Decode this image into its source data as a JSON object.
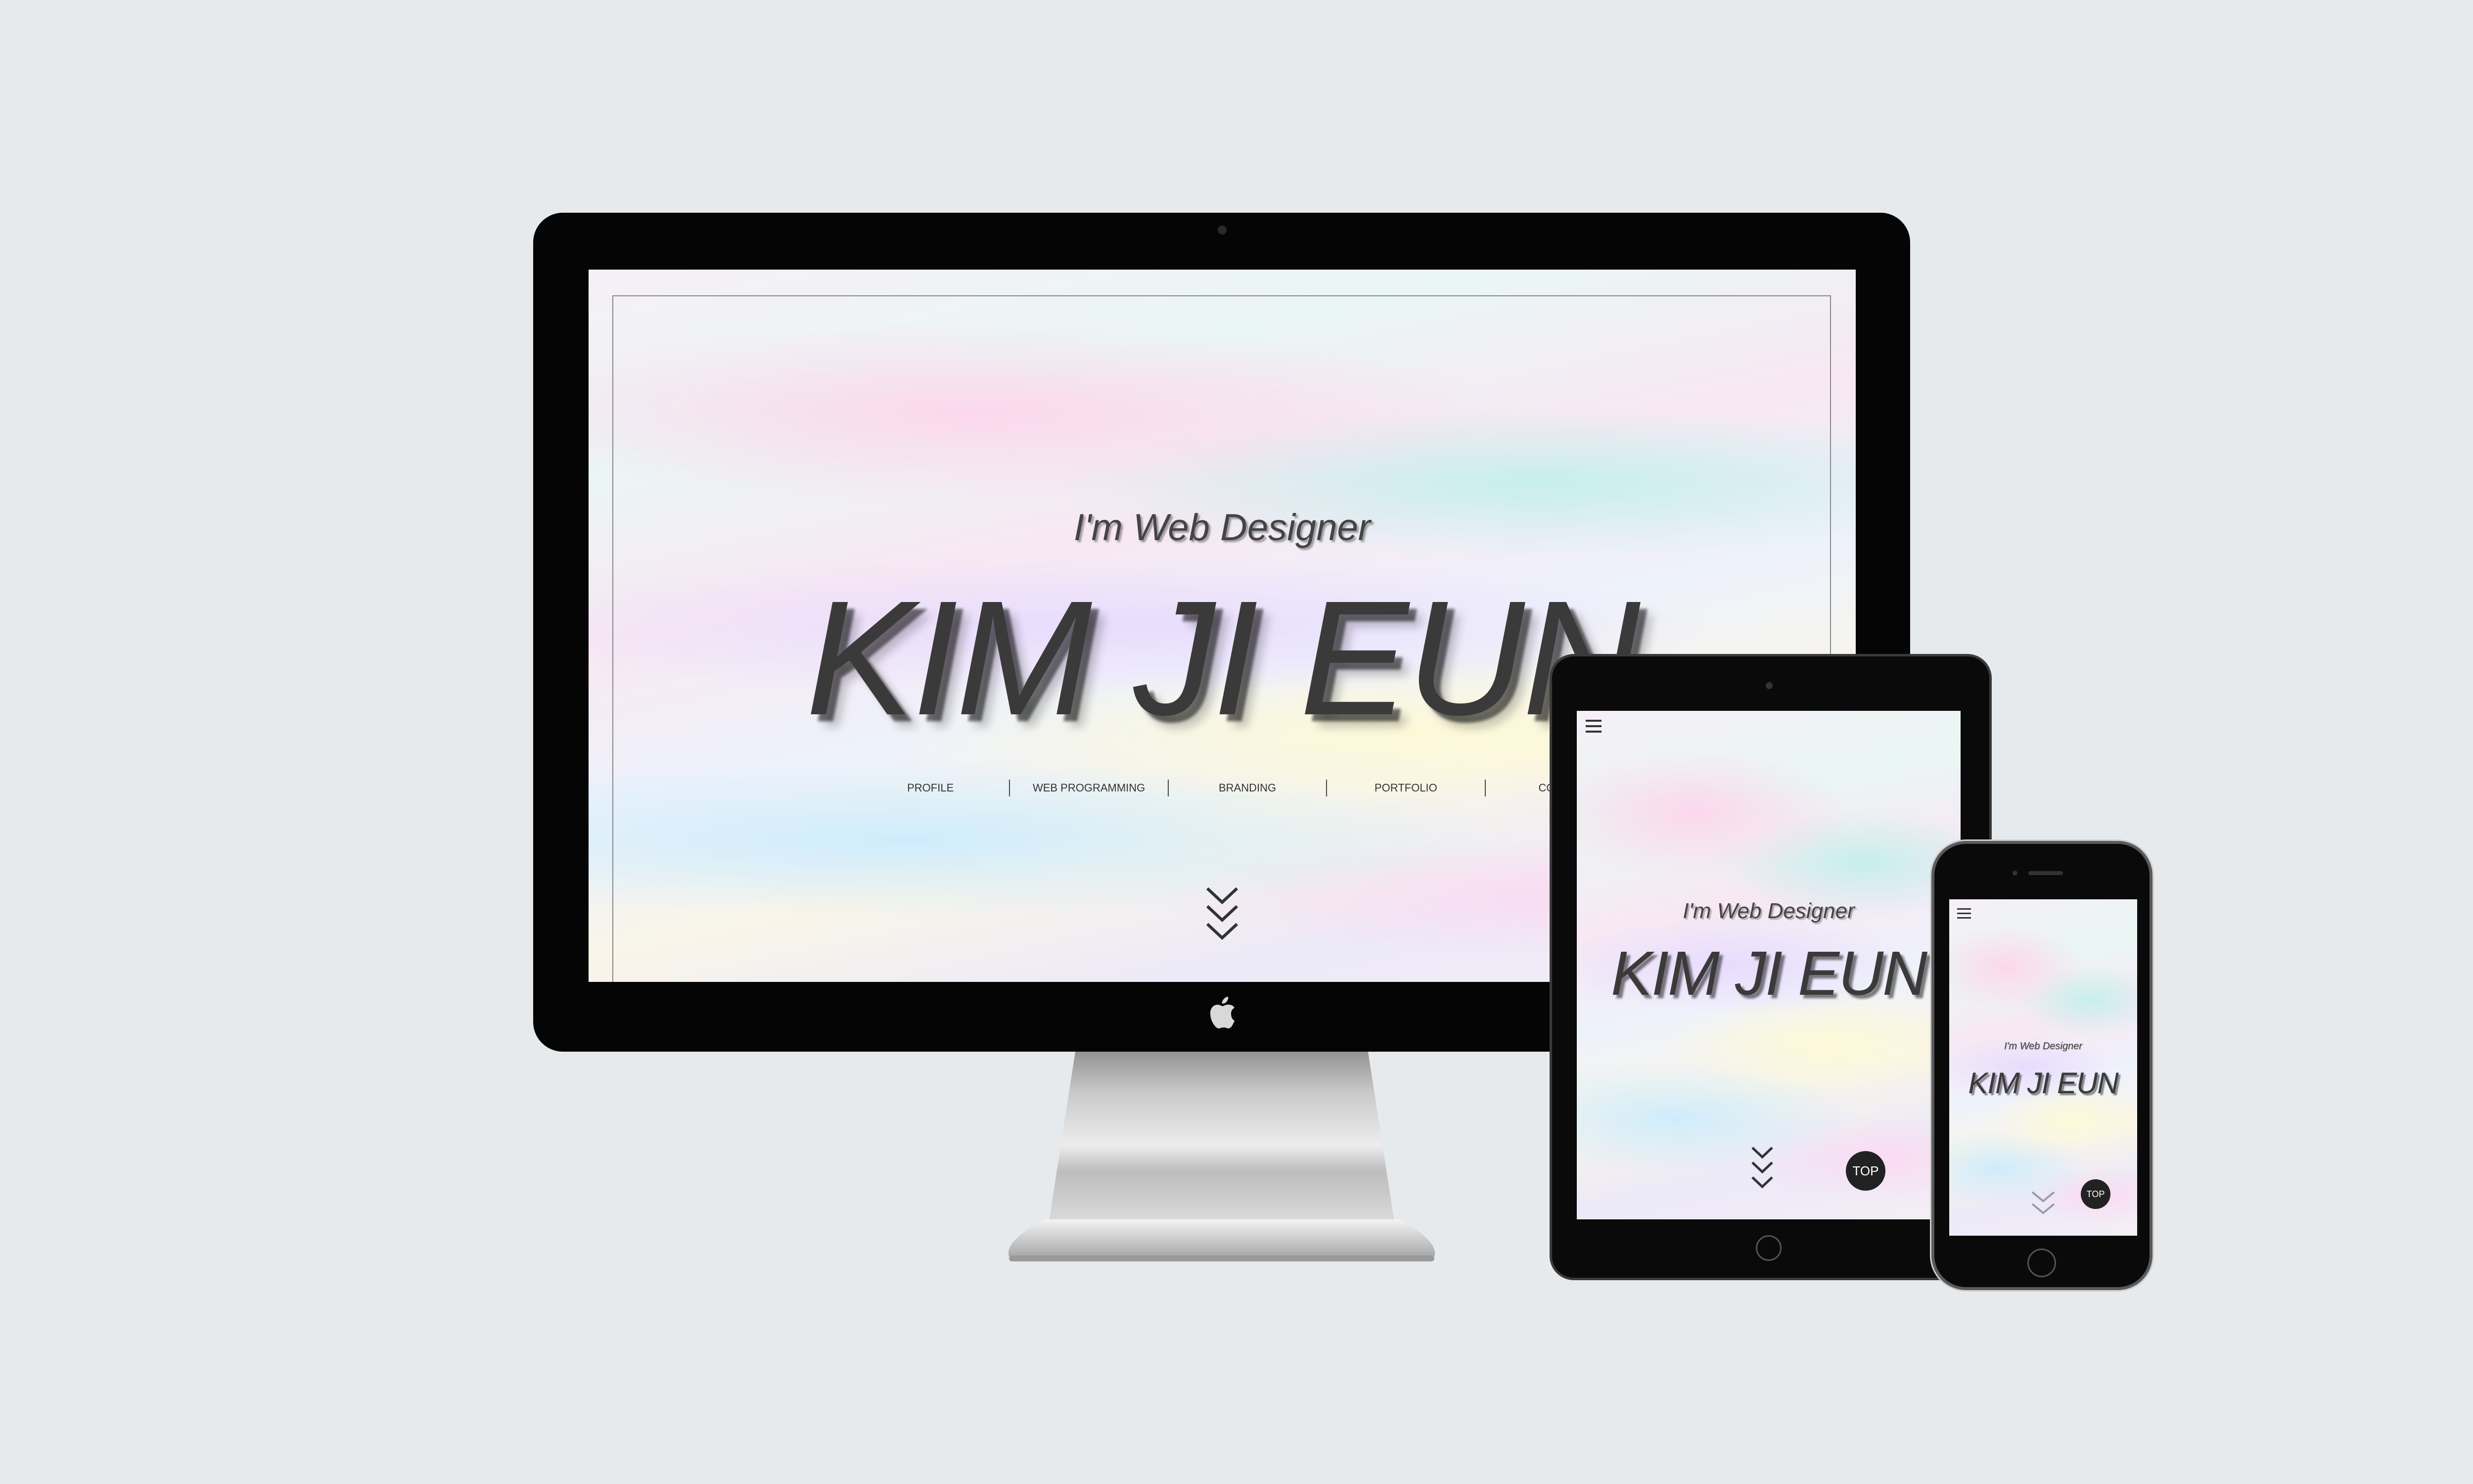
{
  "desktop": {
    "subtitle": "I'm Web Designer",
    "name": "KIM JI EUN",
    "nav": [
      "PROFILE",
      "WEB PROGRAMMING",
      "BRANDING",
      "PORTFOLIO",
      "CONTACT"
    ]
  },
  "tablet": {
    "subtitle": "I'm Web Designer",
    "name": "KIM JI EUN",
    "top_label": "TOP"
  },
  "phone": {
    "subtitle": "I'm Web Designer",
    "name": "KIM JI EUN",
    "top_label": "TOP"
  },
  "icons": {
    "menu": "hamburger-menu-icon",
    "scroll": "triple-chevron-down-icon",
    "brand": "apple-logo-icon"
  },
  "colors": {
    "background": "#e7eaed",
    "bezel": "#050505",
    "text": "#3a3a3a",
    "top_button": "#222222"
  }
}
